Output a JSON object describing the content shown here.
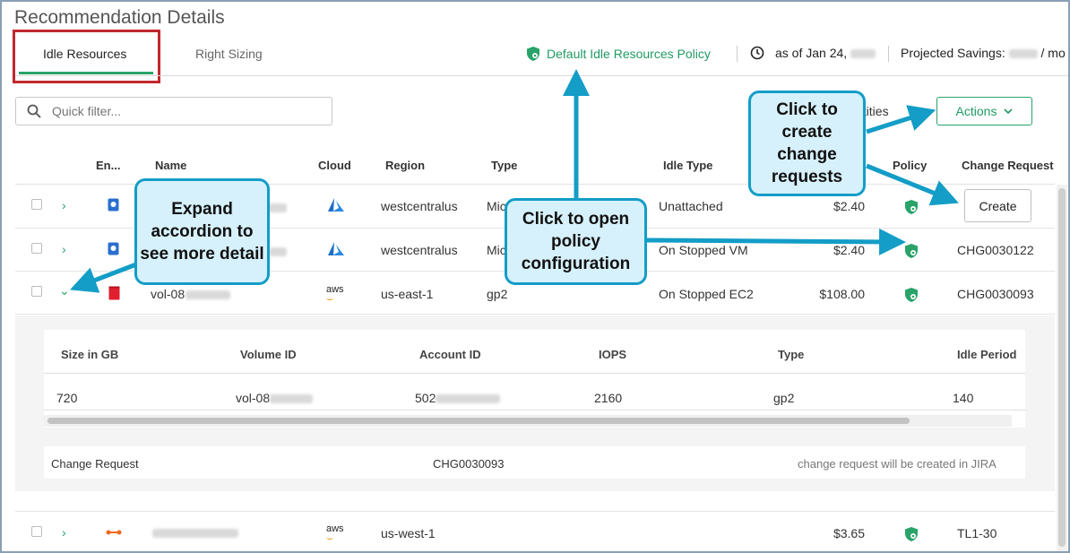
{
  "page_title": "Recommendation Details",
  "tabs": [
    {
      "label": "Idle Resources",
      "active": true
    },
    {
      "label": "Right Sizing",
      "active": false
    }
  ],
  "header": {
    "policy_link": "Default Idle Resources Policy",
    "as_of": "as of Jan 24,",
    "projected_savings": "Projected Savings:",
    "savings_suffix": "/ mo"
  },
  "filter": {
    "placeholder": "Quick filter..."
  },
  "entities_label": "ntities",
  "actions_label": "Actions",
  "table": {
    "columns": [
      "En...",
      "Name",
      "Cloud",
      "Region",
      "Type",
      "Idle Type",
      "Policy",
      "Change Request"
    ],
    "rows": [
      {
        "region": "westcentralus",
        "type": "Mic",
        "idle_type": "Unattached",
        "savings": "$2.40",
        "change_request": "Create",
        "cloud": "azure"
      },
      {
        "region": "westcentralus",
        "type": "Mic",
        "idle_type": "On Stopped VM",
        "savings": "$2.40",
        "change_request": "CHG0030122",
        "cloud": "azure"
      },
      {
        "name": "vol-08",
        "region": "us-east-1",
        "type": "gp2",
        "idle_type": "On Stopped EC2",
        "savings": "$108.00",
        "change_request": "CHG0030093",
        "cloud": "aws"
      },
      {
        "region": "us-west-1",
        "savings": "$3.65",
        "change_request": "TL1-30",
        "cloud": "aws"
      }
    ]
  },
  "detail": {
    "columns": [
      "Size in GB",
      "Volume ID",
      "Account ID",
      "IOPS",
      "Type",
      "Idle Period"
    ],
    "values": [
      "720",
      "vol-08",
      "502",
      "2160",
      "gp2",
      "140"
    ],
    "change_request_label": "Change Request",
    "change_request_value": "CHG0030093",
    "change_request_note": "change request will be created in JIRA"
  },
  "callouts": {
    "expand": "Expand accordion to see more detail",
    "policy": "Click to open policy configuration",
    "create": "Click to create change requests"
  },
  "aws_label": "aws",
  "colors": {
    "accent": "#29a36a",
    "callout_border": "#139dc7",
    "callout_fill": "#d6f1fb",
    "highlight": "#c1272d"
  }
}
